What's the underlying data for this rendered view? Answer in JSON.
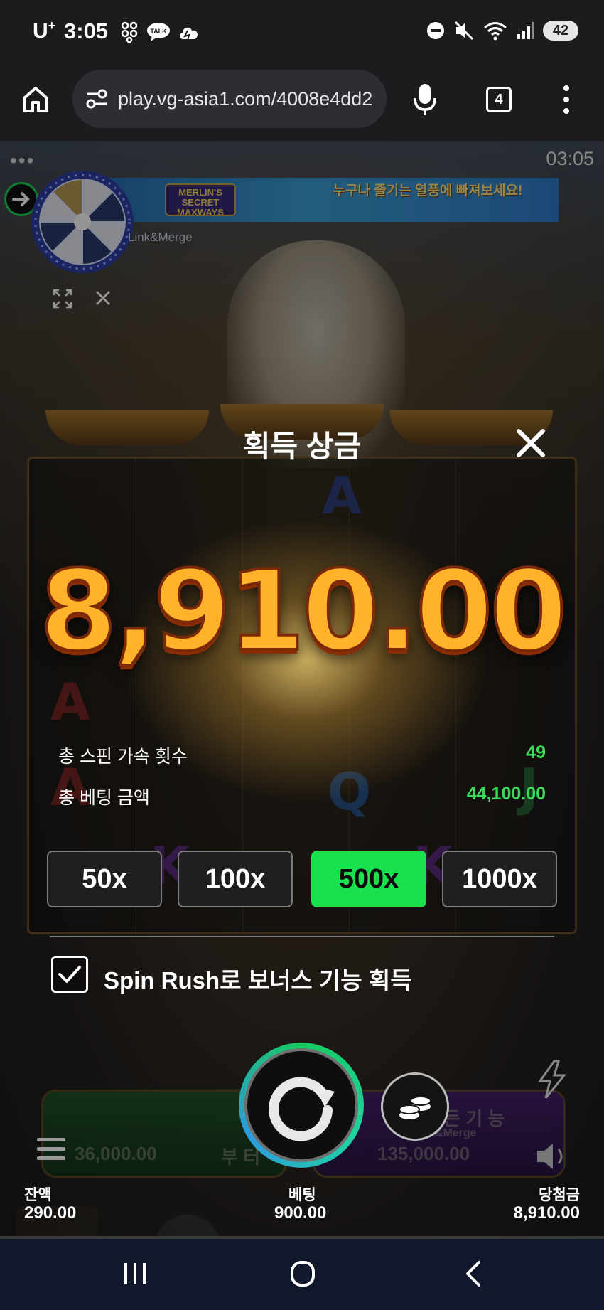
{
  "status_bar": {
    "carrier": "U",
    "carrier_sup": "+",
    "time": "3:05",
    "battery": "42"
  },
  "browser": {
    "url": "play.vg-asia1.com/4008e4dd2",
    "tab_count": "4"
  },
  "game": {
    "clock": "03:05",
    "dots": "•••",
    "banner": {
      "logo_text": "MERLIN'S SECRET MAXWAYS",
      "text": "누구나 즐기는 열풍에 빠져보세요!"
    },
    "logo_sub": "Link&Merge"
  },
  "modal": {
    "title": "획득 상금",
    "amount": "8,910.00",
    "stats": [
      {
        "label": "총 스핀 가속 횟수",
        "value": "49"
      },
      {
        "label": "총 베팅 금액",
        "value": "44,100.00"
      }
    ],
    "multipliers": [
      {
        "label": "50x",
        "active": false
      },
      {
        "label": "100x",
        "active": false
      },
      {
        "label": "500x",
        "active": true
      },
      {
        "label": "1000x",
        "active": false
      }
    ],
    "checkbox_label": "Spin Rush로 보너스 기능 획득",
    "checkbox_checked": true
  },
  "buy_panels": {
    "left_price": "36,000.00",
    "left_suffix": "부 터",
    "right_price": "135,000.00",
    "right_title": "모 든 기 능",
    "right_sub": "Link&Merge"
  },
  "footer": {
    "balance_label": "잔액",
    "balance_value": "290.00",
    "bet_label": "베팅",
    "bet_value": "900.00",
    "win_label": "당첨금",
    "win_value": "8,910.00"
  },
  "colors": {
    "accent_green": "#19e04d",
    "stat_green": "#39d95a",
    "win_gold": "#ffb22a"
  }
}
